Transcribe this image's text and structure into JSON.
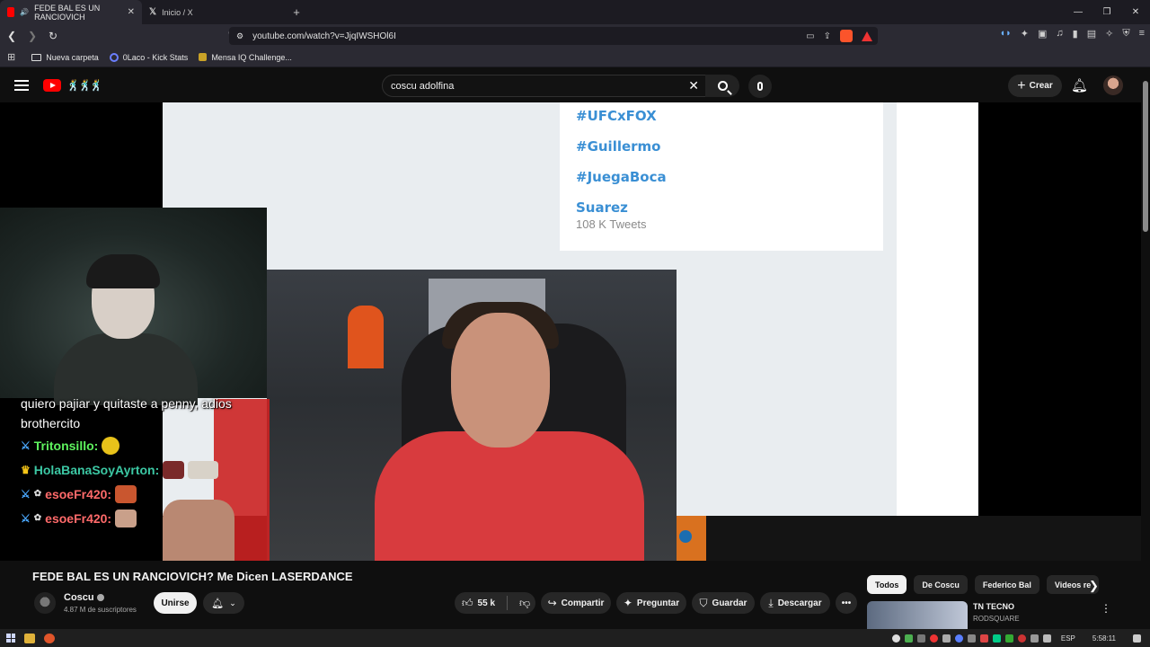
{
  "browser": {
    "tabs": [
      {
        "title": "FEDE BAL ES UN RANCIOVICH",
        "active": true
      },
      {
        "title": "Inicio / X",
        "active": false
      }
    ],
    "url": "youtube.com/watch?v=JjqIWSHOl6I",
    "bookmarks": [
      "Nueva carpeta",
      "0Laco - Kick Stats",
      "Mensa IQ Challenge..."
    ]
  },
  "youtube": {
    "search_value": "coscu adolfina",
    "create_label": "Crear"
  },
  "video_overlay": {
    "trends": [
      "#UFCxFOX",
      "#Guillermo",
      "#JuegaBoca",
      "Suarez"
    ],
    "trend_sub": "108 K Tweets",
    "chat_text": [
      "quiero pajiar y quitaste a penny, adios",
      "brothercito"
    ],
    "chat_users": [
      {
        "name": "Tritonsillo:",
        "color": "#5ef35e"
      },
      {
        "name": "HolaBanaSoyAyrton:",
        "color": "#3cc8a4"
      },
      {
        "name": "esoeFr420:",
        "color": "#ff6a6a"
      },
      {
        "name": "esoeFr420:",
        "color": "#ff6a6a"
      }
    ]
  },
  "video": {
    "title": "FEDE BAL ES UN RANCIOVICH? Me Dicen LASERDANCE",
    "channel": "Coscu",
    "subscribers": "4.87 M de suscriptores",
    "join_label": "Unirse",
    "likes": "55 k",
    "share_label": "Compartir",
    "ask_label": "Preguntar",
    "save_label": "Guardar",
    "download_label": "Descargar"
  },
  "chips": [
    "Todos",
    "De Coscu",
    "Federico Bal",
    "Videos re"
  ],
  "recommendation": {
    "title": "TN TECNO",
    "channel": "RODSQUARE"
  },
  "taskbar": {
    "lang": "ESP",
    "time": "5:58:11"
  }
}
